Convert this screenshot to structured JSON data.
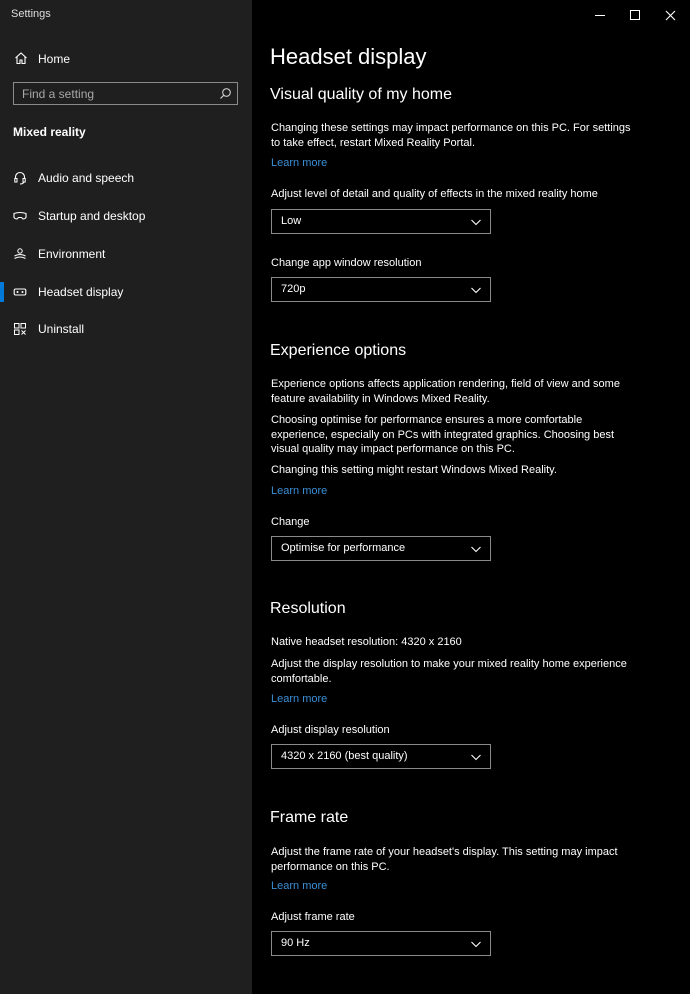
{
  "window": {
    "title": "Settings"
  },
  "sidebar": {
    "home_label": "Home",
    "search_placeholder": "Find a setting",
    "section_title": "Mixed reality",
    "items": [
      {
        "label": "Audio and speech",
        "icon": "headset-mic-icon"
      },
      {
        "label": "Startup and desktop",
        "icon": "mr-headset-icon"
      },
      {
        "label": "Environment",
        "icon": "environment-icon"
      },
      {
        "label": "Headset display",
        "icon": "display-headset-icon",
        "active": true
      },
      {
        "label": "Uninstall",
        "icon": "uninstall-icon"
      }
    ]
  },
  "main": {
    "title": "Headset display",
    "visual_quality": {
      "heading": "Visual quality of my home",
      "desc": "Changing these settings may impact performance on this PC. For settings to take effect, restart Mixed Reality Portal.",
      "learn_more": "Learn more",
      "detail_label": "Adjust level of detail and quality of effects in the mixed reality home",
      "detail_value": "Low",
      "resolution_label": "Change app window resolution",
      "resolution_value": "720p"
    },
    "experience": {
      "heading": "Experience options",
      "desc1": "Experience options affects application rendering, field of view and some feature availability in Windows Mixed Reality.",
      "desc2": "Choosing optimise for performance ensures a more comfortable experience, especially on PCs with integrated graphics. Choosing best visual quality may impact performance on this PC.",
      "desc3": "Changing this setting might restart Windows Mixed Reality.",
      "learn_more": "Learn more",
      "change_label": "Change",
      "change_value": "Optimise for performance"
    },
    "resolution": {
      "heading": "Resolution",
      "native": "Native headset resolution: 4320 x 2160",
      "desc": "Adjust the display resolution to make your mixed reality home experience comfortable.",
      "learn_more": "Learn more",
      "adjust_label": "Adjust display resolution",
      "adjust_value": "4320 x 2160 (best quality)"
    },
    "frame_rate": {
      "heading": "Frame rate",
      "desc": "Adjust the frame rate of your headset's display. This setting may impact performance on this PC.",
      "learn_more": "Learn more",
      "adjust_label": "Adjust frame rate",
      "adjust_value": "90 Hz"
    }
  },
  "colors": {
    "accent": "#0078d7",
    "link": "#3b8fd6",
    "sidebar_bg": "#1f1f1f",
    "main_bg": "#000000"
  }
}
